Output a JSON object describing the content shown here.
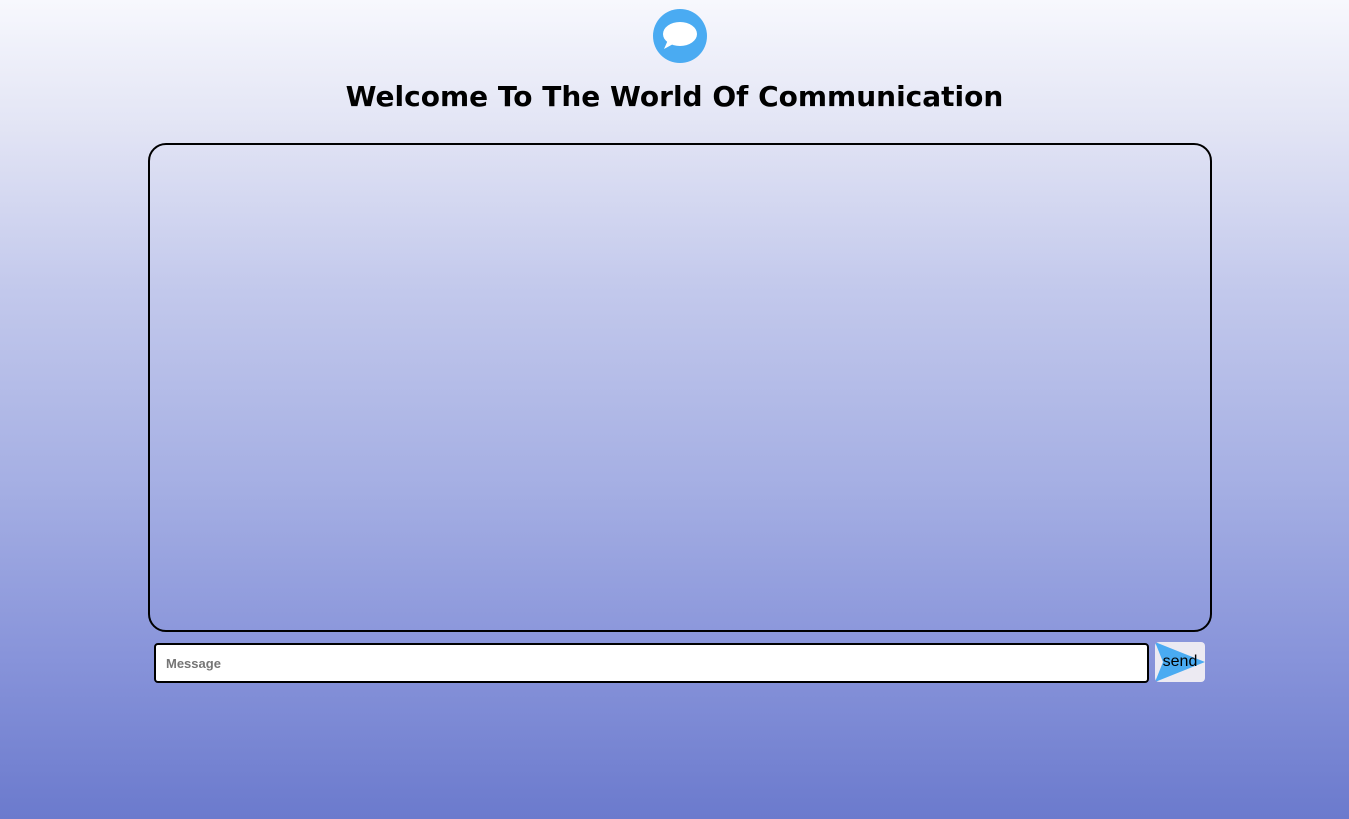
{
  "header": {
    "logo_icon": "chat-bubble-icon",
    "title": "Welcome To The World Of Communication"
  },
  "composer": {
    "message_placeholder": "Message",
    "message_value": "",
    "send_label": "send",
    "send_icon": "send-arrow-icon"
  },
  "colors": {
    "accent": "#4aabf2",
    "background_top": "#f7f8fd",
    "background_bottom": "#6b7acd",
    "border": "#000000"
  }
}
